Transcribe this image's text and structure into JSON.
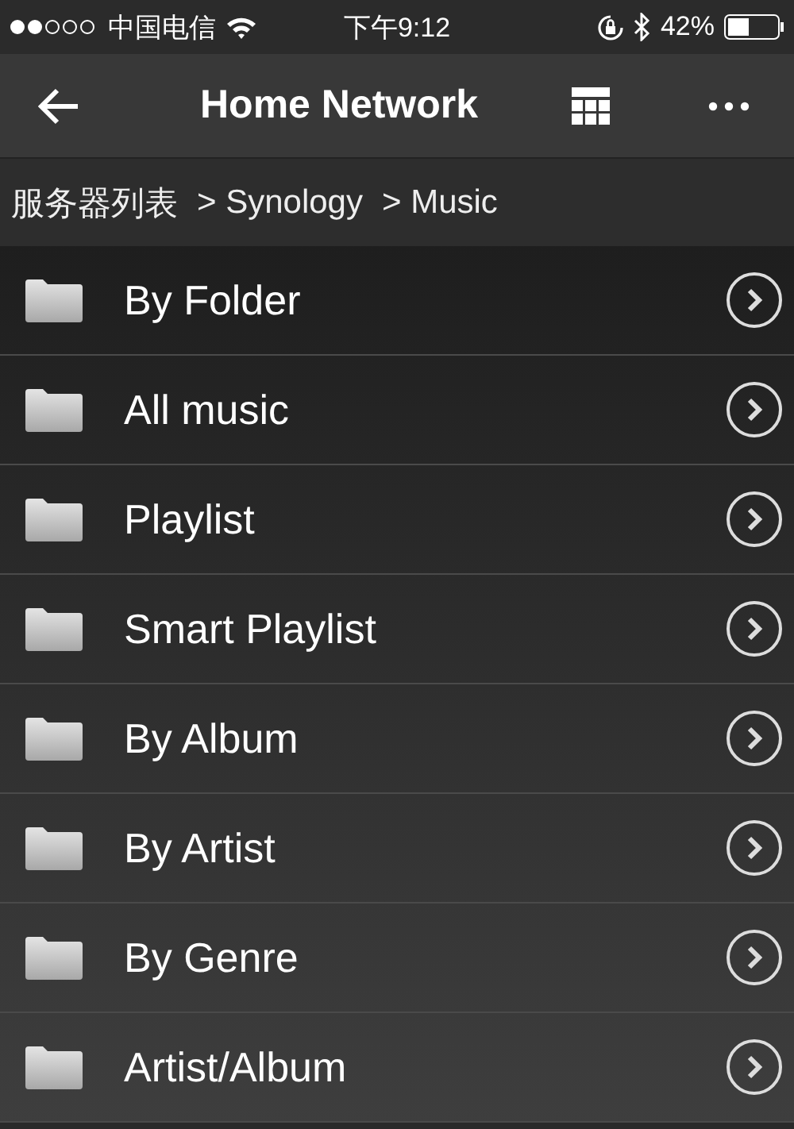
{
  "status_bar": {
    "carrier": "中国电信",
    "time": "下午9:12",
    "battery": "42%"
  },
  "nav_bar": {
    "title": "Home Network"
  },
  "breadcrumb": [
    "服务器列表",
    "> Synology",
    "> Music"
  ],
  "items": [
    {
      "label": "By Folder"
    },
    {
      "label": "All music"
    },
    {
      "label": "Playlist"
    },
    {
      "label": "Smart Playlist"
    },
    {
      "label": "By Album"
    },
    {
      "label": "By Artist"
    },
    {
      "label": "By Genre"
    },
    {
      "label": "Artist/Album"
    }
  ]
}
